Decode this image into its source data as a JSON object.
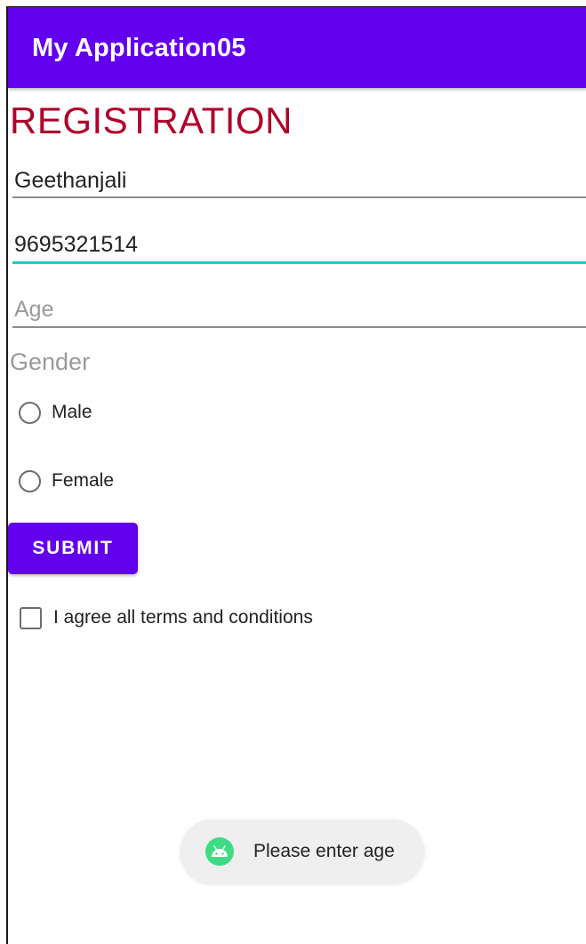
{
  "app": {
    "title": "My Application05"
  },
  "form": {
    "heading": "REGISTRATION",
    "name_value": "Geethanjali",
    "phone_value": "9695321514",
    "age_placeholder": "Age",
    "gender_label": "Gender",
    "gender_options": [
      "Male",
      "Female"
    ],
    "submit_label": "SUBMIT",
    "terms_label": "I agree all terms and conditions"
  },
  "toast": {
    "message": "Please enter age",
    "icon": "android-icon"
  },
  "colors": {
    "primary": "#6200ee",
    "heading": "#b0002a",
    "focus_underline": "#1ccfc1",
    "toast_icon": "#3ddc84"
  }
}
